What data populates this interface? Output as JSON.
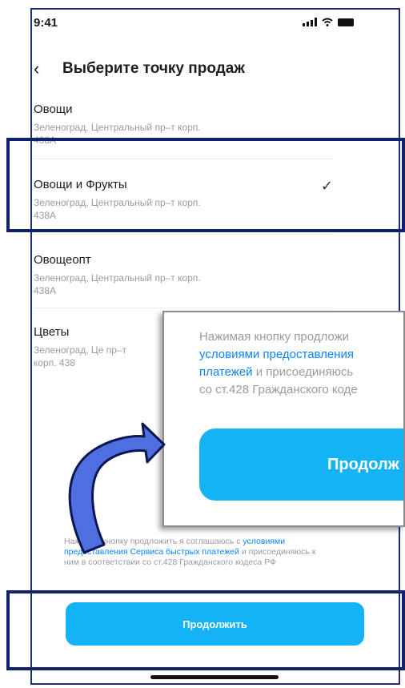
{
  "status_bar": {
    "time": "9:41"
  },
  "header": {
    "title": "Выберите точку продаж"
  },
  "stores": [
    {
      "name": "Овощи",
      "address": "Зеленоград, Центральный пр–т корп. 438А",
      "selected": false
    },
    {
      "name": "Овощи и Фрукты",
      "address": "Зеленоград, Центральный пр–т корп. 438А",
      "selected": true
    },
    {
      "name": "Овощеопт",
      "address": "Зеленоград, Центральный пр–т корп. 438А",
      "selected": false
    },
    {
      "name": "Цветы",
      "address": "Зеленоград, Це пр–т корп. 438",
      "selected": false
    }
  ],
  "terms": {
    "part1": "Нажимая кнопку продложить я соглашаюсь с ",
    "link1": "условиями предоставления Сервиса быстрых платежей",
    "part2": " и присоединяюсь к ним в соответствии со ст.428 Гражданского кодеса РФ"
  },
  "cta_label": "Продолжить",
  "zoom": {
    "line1": "Нажимая кнопку продложи",
    "line2_link": "условиями предоставления",
    "line3_link": "платежей",
    "line3_rest": " и присоединяюсь",
    "line4": "со ст.428 Гражданского коде",
    "button": "Продолж"
  },
  "colors": {
    "accent": "#14b3f5",
    "link": "#0a84ff",
    "highlight_border": "#12216b",
    "arrow": "#4f6fe0"
  }
}
